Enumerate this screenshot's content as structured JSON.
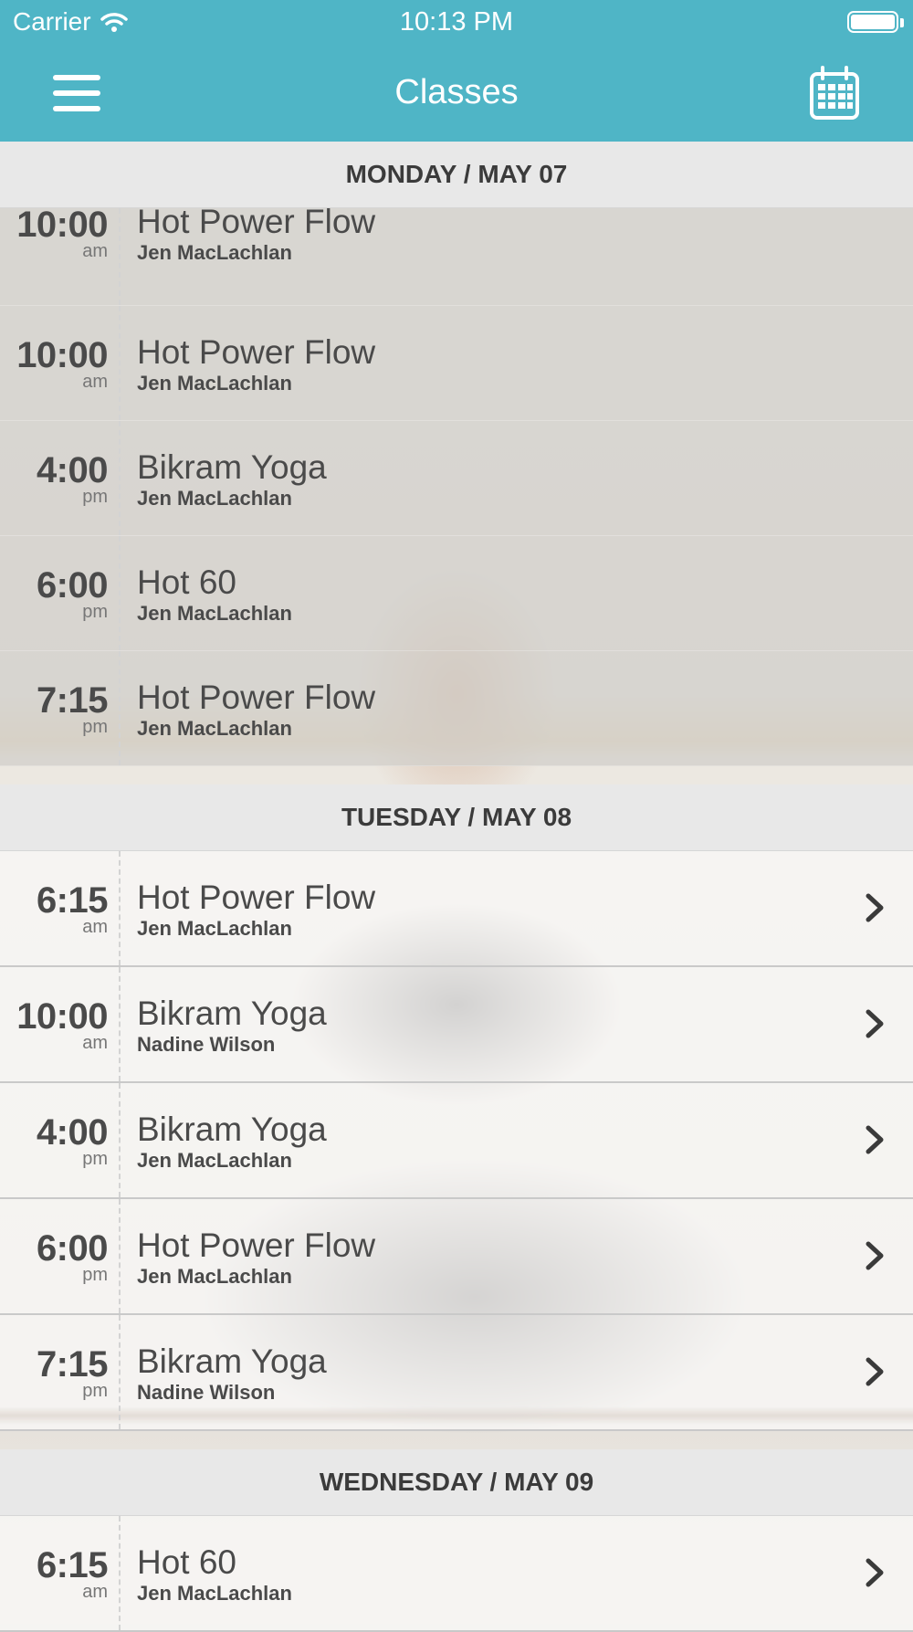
{
  "status_bar": {
    "carrier": "Carrier",
    "time": "10:13 PM"
  },
  "nav": {
    "title": "Classes"
  },
  "colors": {
    "accent": "#4fb5c6"
  },
  "icons": {
    "menu": "hamburger-menu-icon",
    "calendar": "calendar-icon",
    "row_action": "chevron-right-icon"
  },
  "days": [
    {
      "label": "MONDAY / MAY 07",
      "classes": [
        {
          "time": "10:00",
          "ampm": "am",
          "name": "Hot Power Flow",
          "instructor": "Jen MacLachlan"
        },
        {
          "time": "10:00",
          "ampm": "am",
          "name": "Hot Power Flow",
          "instructor": "Jen MacLachlan"
        },
        {
          "time": "4:00",
          "ampm": "pm",
          "name": "Bikram Yoga",
          "instructor": "Jen MacLachlan"
        },
        {
          "time": "6:00",
          "ampm": "pm",
          "name": "Hot 60",
          "instructor": "Jen MacLachlan"
        },
        {
          "time": "7:15",
          "ampm": "pm",
          "name": "Hot Power Flow",
          "instructor": "Jen MacLachlan"
        }
      ]
    },
    {
      "label": "TUESDAY / MAY 08",
      "classes": [
        {
          "time": "6:15",
          "ampm": "am",
          "name": "Hot Power Flow",
          "instructor": "Jen MacLachlan"
        },
        {
          "time": "10:00",
          "ampm": "am",
          "name": "Bikram Yoga",
          "instructor": "Nadine Wilson"
        },
        {
          "time": "4:00",
          "ampm": "pm",
          "name": "Bikram Yoga",
          "instructor": "Jen MacLachlan"
        },
        {
          "time": "6:00",
          "ampm": "pm",
          "name": "Hot Power Flow",
          "instructor": "Jen MacLachlan"
        },
        {
          "time": "7:15",
          "ampm": "pm",
          "name": "Bikram Yoga",
          "instructor": "Nadine Wilson"
        }
      ]
    },
    {
      "label": "WEDNESDAY / MAY 09",
      "classes": [
        {
          "time": "6:15",
          "ampm": "am",
          "name": "Hot 60",
          "instructor": "Jen MacLachlan"
        }
      ]
    }
  ]
}
